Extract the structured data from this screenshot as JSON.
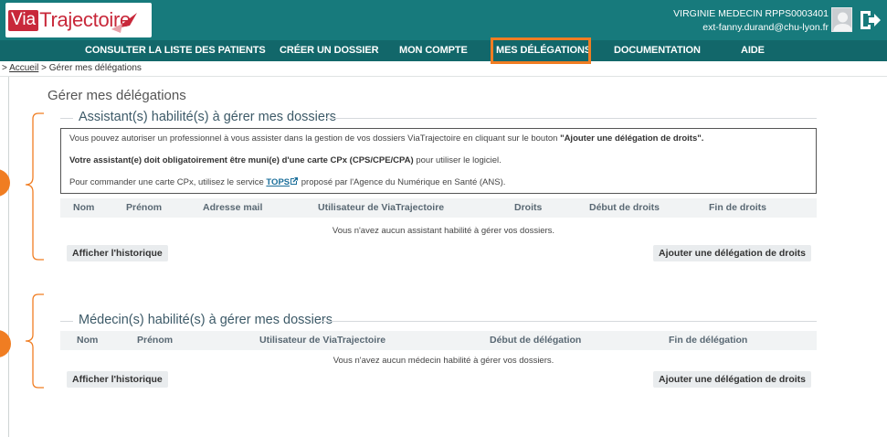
{
  "header": {
    "logo_via": "Via",
    "logo_trajectoire": "Trajectoire",
    "user_name": "VIRGINIE MEDECIN RPPS0003401",
    "user_email": "ext-fanny.durand@chu-lyon.fr"
  },
  "nav": {
    "items": [
      {
        "label": "CONSULTER LA LISTE DES PATIENTS"
      },
      {
        "label": "CRÉER UN DOSSIER"
      },
      {
        "label": "MON COMPTE"
      },
      {
        "label": "MES DÉLÉGATIONS"
      },
      {
        "label": "DOCUMENTATION"
      },
      {
        "label": "AIDE"
      }
    ],
    "active_index": 3
  },
  "breadcrumb": {
    "sep": ">",
    "home": "Accueil",
    "current": "Gérer mes délégations"
  },
  "page_title": "Gérer mes délégations",
  "assistants": {
    "title": "Assistant(s) habilité(s) à gérer mes dossiers",
    "info_line1_start": "Vous pouvez autoriser un professionnel à vous assister dans la gestion de vos dossiers ViaTrajectoire en cliquant sur le bouton",
    "info_line1_bold": "\"Ajouter une délégation de droits\".",
    "info_line2_bold": "Votre assistant(e) doit obligatoirement être muni(e) d'une carte CPx (CPS/CPE/CPA)",
    "info_line2_end": "pour utiliser le logiciel.",
    "info_line3_start": "Pour commander une carte CPx, utilisez le service",
    "info_line3_link": "TOPS",
    "info_line3_end": "proposé par l'Agence du Numérique en Santé (ANS).",
    "columns": [
      "Nom",
      "Prénom",
      "Adresse mail",
      "Utilisateur de ViaTrajectoire",
      "Droits",
      "Début de droits",
      "Fin de droits"
    ],
    "empty_text": "Vous n'avez aucun assistant habilité à gérer vos dossiers.",
    "history_button": "Afficher l'historique",
    "add_button": "Ajouter une délégation de droits"
  },
  "medecins": {
    "title": "Médecin(s) habilité(s) à gérer mes dossiers",
    "columns": [
      "Nom",
      "Prénom",
      "Utilisateur de ViaTrajectoire",
      "Début de délégation",
      "Fin de délégation"
    ],
    "empty_text": "Vous n'avez aucun médecin habilité à gérer vos dossiers.",
    "history_button": "Afficher l'historique",
    "add_button": "Ajouter une délégation de droits"
  },
  "colors": {
    "header_bg": "#177a7c",
    "nav_bg": "#12676a",
    "highlight": "#f07d22",
    "brand_red": "#c8283a"
  },
  "icons": [
    "logo-arrow-icon",
    "user-avatar-icon",
    "logout-icon",
    "external-link-icon"
  ]
}
